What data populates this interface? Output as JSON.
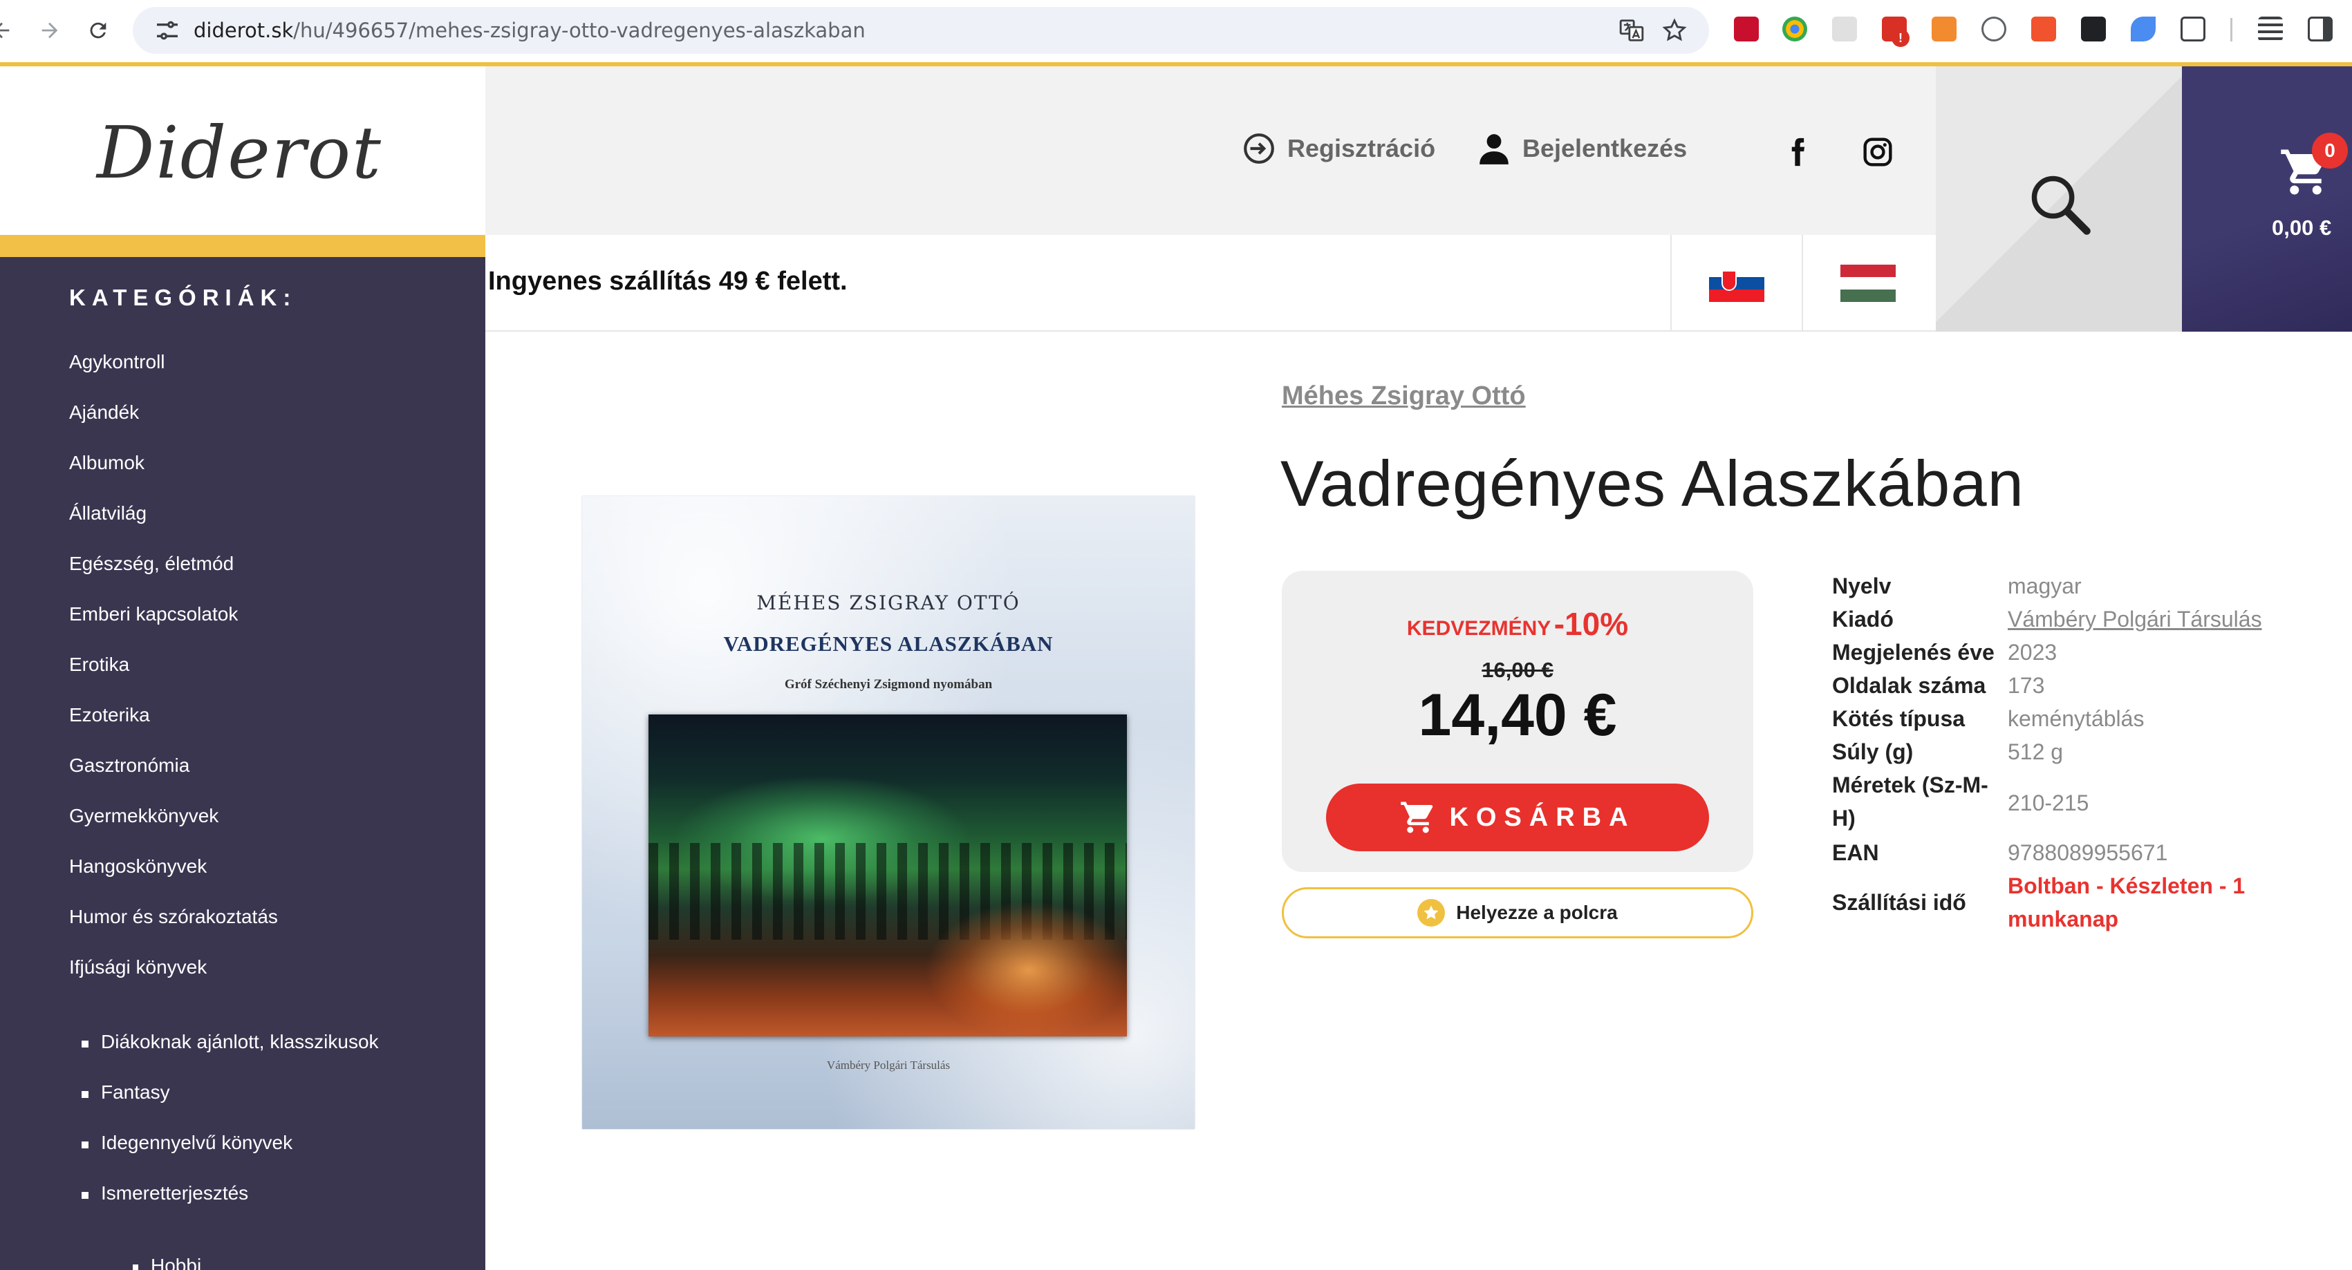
{
  "browser": {
    "url_host": "diderot.sk",
    "url_path": "/hu/496657/mehes-zsigray-otto-vadregenyes-alaszkaban"
  },
  "site": {
    "logo": "Diderot",
    "register_label": "Regisztráció",
    "login_label": "Bejelentkezés",
    "cart_count": "0",
    "cart_total": "0,00 €",
    "shipping_notice": "Ingyenes szállítás 49 € felett.",
    "languages": [
      "sk",
      "hu"
    ]
  },
  "sidebar": {
    "title": "KATEGÓRIÁK:",
    "items": [
      "Agykontroll",
      "Ajándék",
      "Albumok",
      "Állatvilág",
      "Egészség, életmód",
      "Emberi kapcsolatok",
      "Erotika",
      "Ezoterika",
      "Gasztronómia",
      "Gyermekkönyvek",
      "Hangoskönyvek",
      "Humor és szórakoztatás",
      "Ifjúsági könyvek"
    ],
    "subitems": [
      "Diákoknak ajánlott, klasszikusok",
      "Fantasy",
      "Idegennyelvű könyvek",
      "Ismeretterjesztés"
    ],
    "subsubitems": [
      "Hobbi"
    ]
  },
  "cover": {
    "author": "MÉHES ZSIGRAY OTTÓ",
    "title": "VADREGÉNYES ALASZKÁBAN",
    "subtitle": "Gróf Széchenyi Zsigmond nyomában",
    "publisher": "Vámbéry Polgári Társulás"
  },
  "product": {
    "author": "Méhes Zsigray Ottó",
    "title": "Vadregényes Alaszkában",
    "discount_label": "KEDVEZMÉNY",
    "discount_value": "-10%",
    "old_price": "16,00 €",
    "new_price": "14,40 €",
    "add_to_cart_label": "KOSÁRBA",
    "shelf_label": "Helyezze a polcra"
  },
  "specs": [
    {
      "label": "Nyelv",
      "value": "magyar"
    },
    {
      "label": "Kiadó",
      "value": "Vámbéry Polgári Társulás"
    },
    {
      "label": "Megjelenés éve",
      "value": "2023"
    },
    {
      "label": "Oldalak száma",
      "value": "173"
    },
    {
      "label": "Kötés típusa",
      "value": "keménytáblás"
    },
    {
      "label": "Súly (g)",
      "value": "512 g"
    },
    {
      "label_line1": "Méretek (Sz-M-",
      "label_line2": "H)",
      "value": "210-215"
    },
    {
      "label": "EAN",
      "value": "9788089955671"
    },
    {
      "label": "Szállítási idő",
      "value_line1": "Boltban - Készleten - 1",
      "value_line2": "munkanap"
    }
  ],
  "colors": {
    "accent_yellow": "#f2c046",
    "sidebar_bg": "#3a3650",
    "cart_bg": "#3f3a6e",
    "discount_red": "#e8332f"
  },
  "icons": [
    "back-icon",
    "forward-icon",
    "reload-icon",
    "site-settings-icon",
    "translate-icon",
    "bookmark-star-icon",
    "register-icon",
    "user-icon",
    "facebook-icon",
    "instagram-icon",
    "search-icon",
    "cart-icon",
    "star-icon"
  ]
}
